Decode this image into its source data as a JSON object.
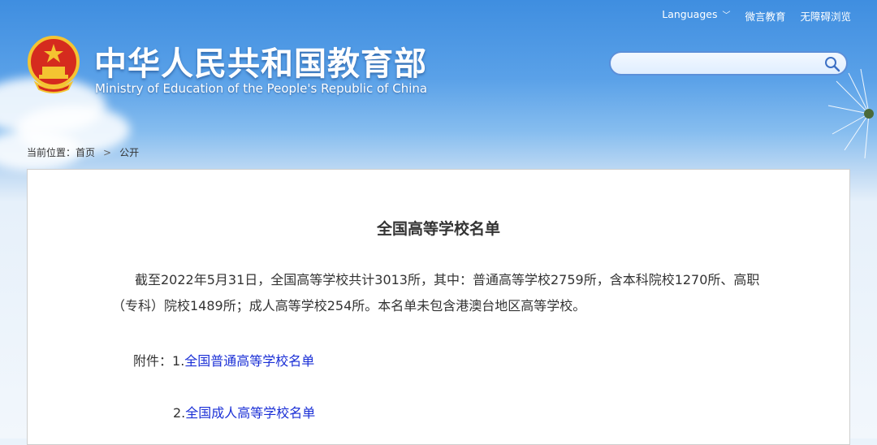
{
  "header": {
    "title_cn": "中华人民共和国教育部",
    "title_en": "Ministry of Education of the People's Republic of China"
  },
  "topnav": {
    "languages": "Languages",
    "wechat": "微言教育",
    "accessible": "无障碍浏览"
  },
  "search": {
    "value": "",
    "placeholder": ""
  },
  "breadcrumb": {
    "label": "当前位置：",
    "home": "首页",
    "separator": ">",
    "current": "公开"
  },
  "article": {
    "title": "全国高等学校名单",
    "paragraph": "截至2022年5月31日，全国高等学校共计3013所，其中：普通高等学校2759所，含本科院校1270所、高职（专科）院校1489所；成人高等学校254所。本名单未包含港澳台地区高等学校。",
    "attachments_label": "附件：",
    "attachment1_num": "1.",
    "attachment1": "全国普通高等学校名单",
    "attachment2_num": "2.",
    "attachment2": "全国成人高等学校名单"
  },
  "colors": {
    "banner": "#4a93e3",
    "link": "#1a2fd6",
    "text": "#333333"
  }
}
